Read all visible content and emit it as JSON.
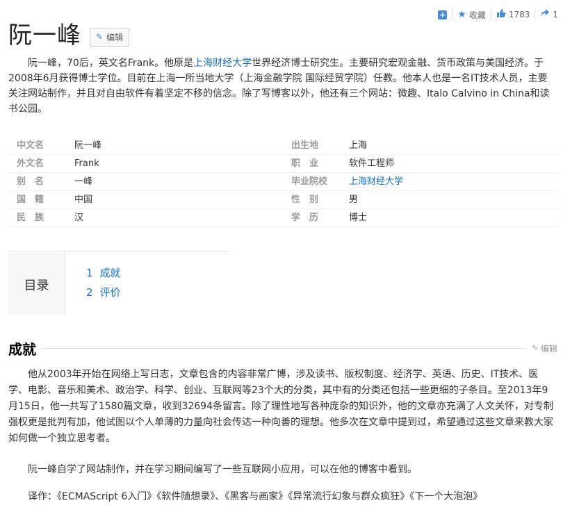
{
  "topbar": {
    "collect_label": "收藏",
    "like_count": "1783",
    "share_count": "1"
  },
  "header": {
    "title": "阮一峰",
    "edit_label": "编辑"
  },
  "summary": {
    "part1": "阮一峰，70后，英文名Frank。他原是",
    "link": "上海财经大学",
    "part2": "世界经济博士研究生。主要研究宏观金融、货币政策与美国经济。于2008年6月获得博士学位。目前在上海一所当地大学（上海金融学院 国际经贸学院）任教。他本人也是一名IT技术人员，主要关注网站制作，并且对自由软件有着坚定不移的信念。除了写博客以外，他还有三个网站：微趣、Italo Calvino in China和读书公园。"
  },
  "info": {
    "rows": [
      {
        "k1": "中文名",
        "v1": "阮一峰",
        "k2": "出生地",
        "v2": "上海"
      },
      {
        "k1": "外文名",
        "v1": "Frank",
        "k2": "职　业",
        "v2": "软件工程师"
      },
      {
        "k1": "别　名",
        "v1": "一峰",
        "k2": "毕业院校",
        "v2": "上海财经大学"
      },
      {
        "k1": "国　籍",
        "v1": "中国",
        "k2": "性　别",
        "v2": "男"
      },
      {
        "k1": "民　族",
        "v1": "汉",
        "k2": "学　历",
        "v2": "博士"
      }
    ]
  },
  "toc": {
    "label": "目录",
    "items": [
      {
        "num": "1",
        "label": "成就"
      },
      {
        "num": "2",
        "label": "评价"
      }
    ]
  },
  "section": {
    "title": "成就",
    "edit_label": "编辑",
    "p1": "他从2003年开始在网络上写日志，文章包含的内容非常广博，涉及读书、版权制度、经济学、英语、历史、IT技术、医学、电影、音乐和美术、政治学、科学、创业、互联网等23个大的分类，其中有的分类还包括一些更细的子条目。至2013年9月15日，他一共写了1580篇文章，收到32694条留言。除了理性地写各种庞杂的知识外，他的文章亦充满了人文关怀，对专制强权更是批判有加，他试图以个人单薄的力量向社会传达一种向善的理想。他多次在文章中提到过，希望通过这些文章来教大家如何做一个独立思考者。",
    "p2": "阮一峰自学了网站制作，并在学习期间编写了一些互联网小应用，可以在他的博客中看到。",
    "p3": "译作：《ECMAScript 6入门》《软件随想录》、《黑客与画家》《异常流行幻象与群众疯狂》《下一个大泡泡》"
  },
  "colors": {
    "link": "#136ec2",
    "accent": "#4a8ad6"
  }
}
